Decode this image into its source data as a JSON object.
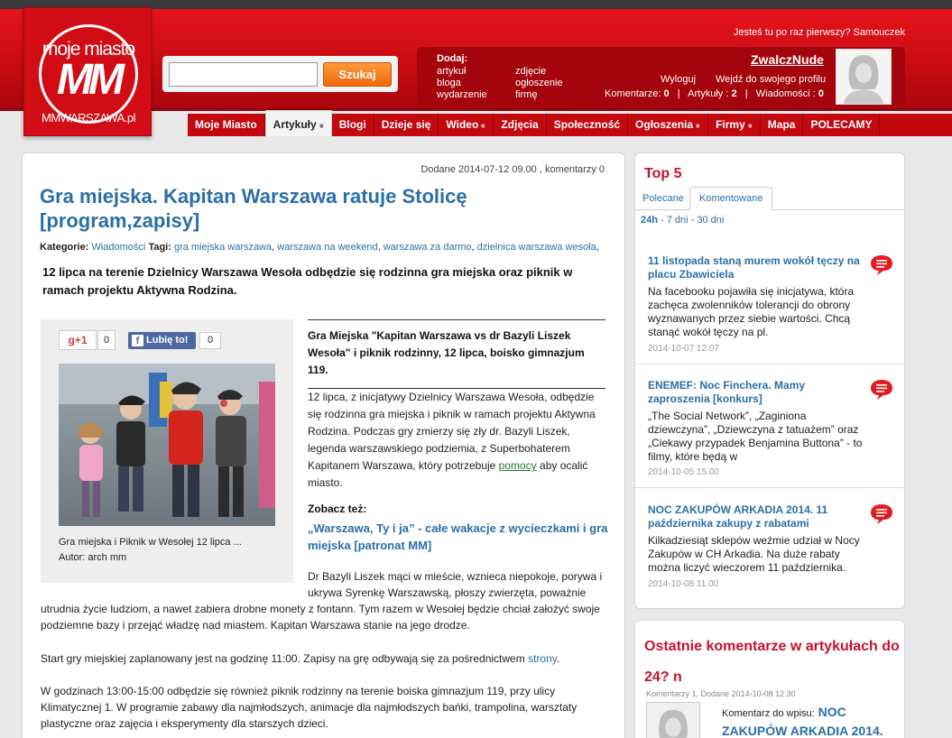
{
  "logo": {
    "line1": "moje miasto",
    "line2": "MM",
    "line3": "MMWARSZAWA.pl"
  },
  "search": {
    "placeholder": "",
    "button_label": "Szukaj"
  },
  "header": {
    "first_time_text": "Jesteś tu po raz pierwszy? Samouczek",
    "add_title": "Dodaj:",
    "add_col1": [
      "artykuł",
      "bloga",
      "wydarzenie"
    ],
    "add_col2": [
      "zdjęcie",
      "ogłoszenie",
      "firmę"
    ],
    "username": "ZwalczNude",
    "logout": "Wyloguj",
    "profile": "Wejdź do swojego profilu",
    "counters": [
      {
        "label": "Komentarze:",
        "value": "0"
      },
      {
        "label": "Artykuły :",
        "value": "2"
      },
      {
        "label": "Wiadomości :",
        "value": "0"
      }
    ]
  },
  "nav": [
    {
      "label": "Moje Miasto",
      "chevron": false
    },
    {
      "label": "Artykuły",
      "chevron": true,
      "active": true
    },
    {
      "label": "Blogi",
      "chevron": false
    },
    {
      "label": "Dzieje się",
      "chevron": false
    },
    {
      "label": "Wideo",
      "chevron": true
    },
    {
      "label": "Zdjęcia",
      "chevron": false
    },
    {
      "label": "Społeczność",
      "chevron": false
    },
    {
      "label": "Ogłoszenia",
      "chevron": true
    },
    {
      "label": "Firmy",
      "chevron": true
    },
    {
      "label": "Mapa",
      "chevron": false
    },
    {
      "label": "POLECAMY",
      "chevron": false
    }
  ],
  "article": {
    "date_line": "Dodane 2014-07-12 09.00 , komentarzy 0",
    "title": "Gra miejska. Kapitan Warszawa ratuje Stolicę [program,zapisy]",
    "categories_label": "Kategorie:",
    "category": "Wiadomości",
    "tags_label": "Tagi:",
    "tags": [
      "gra miejska warszawa",
      "warszawa na weekend",
      "warszawa za darmo",
      "dzielnica warszawa wesoła"
    ],
    "lead": "12 lipca na terenie Dzielnicy Warszawa Wesoła odbędzie się rodzinna gra miejska oraz piknik w ramach projektu Aktywna Rodzina.",
    "gplus_label": "g+1",
    "gplus_count": "0",
    "fb_label": "Lubię to!",
    "fb_count": "0",
    "photo_caption": "Gra miejska i Piknik w Wesołej 12 lipca ...",
    "photo_author": "Autor: arch mm",
    "quote": "Gra Miejska \"Kapitan Warszawa vs dr Bazyli Liszek Wesoła\" i piknik rodzinny, 12 lipca, boisko gimnazjum 119.",
    "p1_before": "12 lipca, z inicjatywy Dzielnicy Warszawa Wesoła, odbędzie się rodzinna gra miejska i piknik w ramach projektu Aktywna Rodzina. Podczas gry zmierzy się zły dr. Bazyli Liszek, legenda warszawskiego podziemia, z Superbohaterem Kapitanem Warszawa, który potrzebuje ",
    "p1_link": "pomocy",
    "p1_after": " aby ocalić miasto.",
    "see_also_label": "Zobacz też:",
    "see_also_link": "„Warszawa, Ty i ja” - całe wakacje z wycieczkami i gra miejska [patronat MM]",
    "p2a": "Dr Bazyli Liszek mąci w mieście, wznieca niepokoje, porywa i ukrywa Syrenkę Warszawską, płoszy zwierzęta, poważnie",
    "p2b": "utrudnia życie ludziom, a nawet zabiera drobne monety z fontann. Tym razem w Wesołej będzie chciał założyć swoje podziemne bazy i przejąć władzę nad miastem. Kapitan Warszawa stanie na jego drodze.",
    "p3_before": "Start gry miejskiej zaplanowany jest na godzinę 11:00. Zapisy na grę odbywają się za pośrednictwem ",
    "p3_link": "strony",
    "p3_after": ".",
    "p4": "W godzinach 13:00-15:00 odbędzie się również piknik rodzinny na terenie boiska gimnazjum 119, przy ulicy Klimatycznej 1. W programie zabawy dla najmłodszych, animacje dla najmłodszych bańki, trampolina, warsztaty plastyczne oraz zajęcia i eksperymenty dla starszych dzieci."
  },
  "top5": {
    "title": "Top 5",
    "tab1": "Polecane",
    "tab2": "Komentowane",
    "range_active": "24h",
    "range_sep": " - ",
    "range_7": "7 dni",
    "range_30": "30 dni",
    "items": [
      {
        "title": "11 listopada staną murem wokół tęczy na placu Zbawiciela",
        "body": "Na facebooku pojawiła się inicjatywa, która zachęca zwolenników tolerancji do obrony wyznawanych przez siebie wartości. Chcą stanąć wokół tęczy na pl.",
        "date": "2014-10-07 12.07"
      },
      {
        "title": "ENEMEF: Noc Fincherа. Mamy zaproszenia [konkurs]",
        "body": "„The Social Network”, „Zaginiona dziewczyna”, „Dziewczyna z tatuażem” oraz „Ciekawy przypadek Benjamina Buttona” - to filmy, które będą w",
        "date": "2014-10-05 15.00"
      },
      {
        "title": "NOC ZAKUPÓW ARKADIA 2014. 11 października zakupy z rabatami",
        "body": "Kilkadziesiąt sklepów weźmie udział w Nocy Zakupów w CH Arkadia. Na duże rabaty można liczyć wieczorem 11 października.",
        "date": "2014-10-08 11.00"
      }
    ]
  },
  "comments": {
    "title": "Ostatnie komentarze w artykułach do 24? n",
    "meta": "Komentarzy 1, Dodane 2014-10-08 12.30",
    "label": "Komentarz do wpisu:",
    "entry": "NOC ZAKUPÓW ARKADIA 2014."
  },
  "colors": {
    "brand_red": "#d20c14",
    "link_blue": "#2a6fa8",
    "heading_red": "#c8102e"
  }
}
